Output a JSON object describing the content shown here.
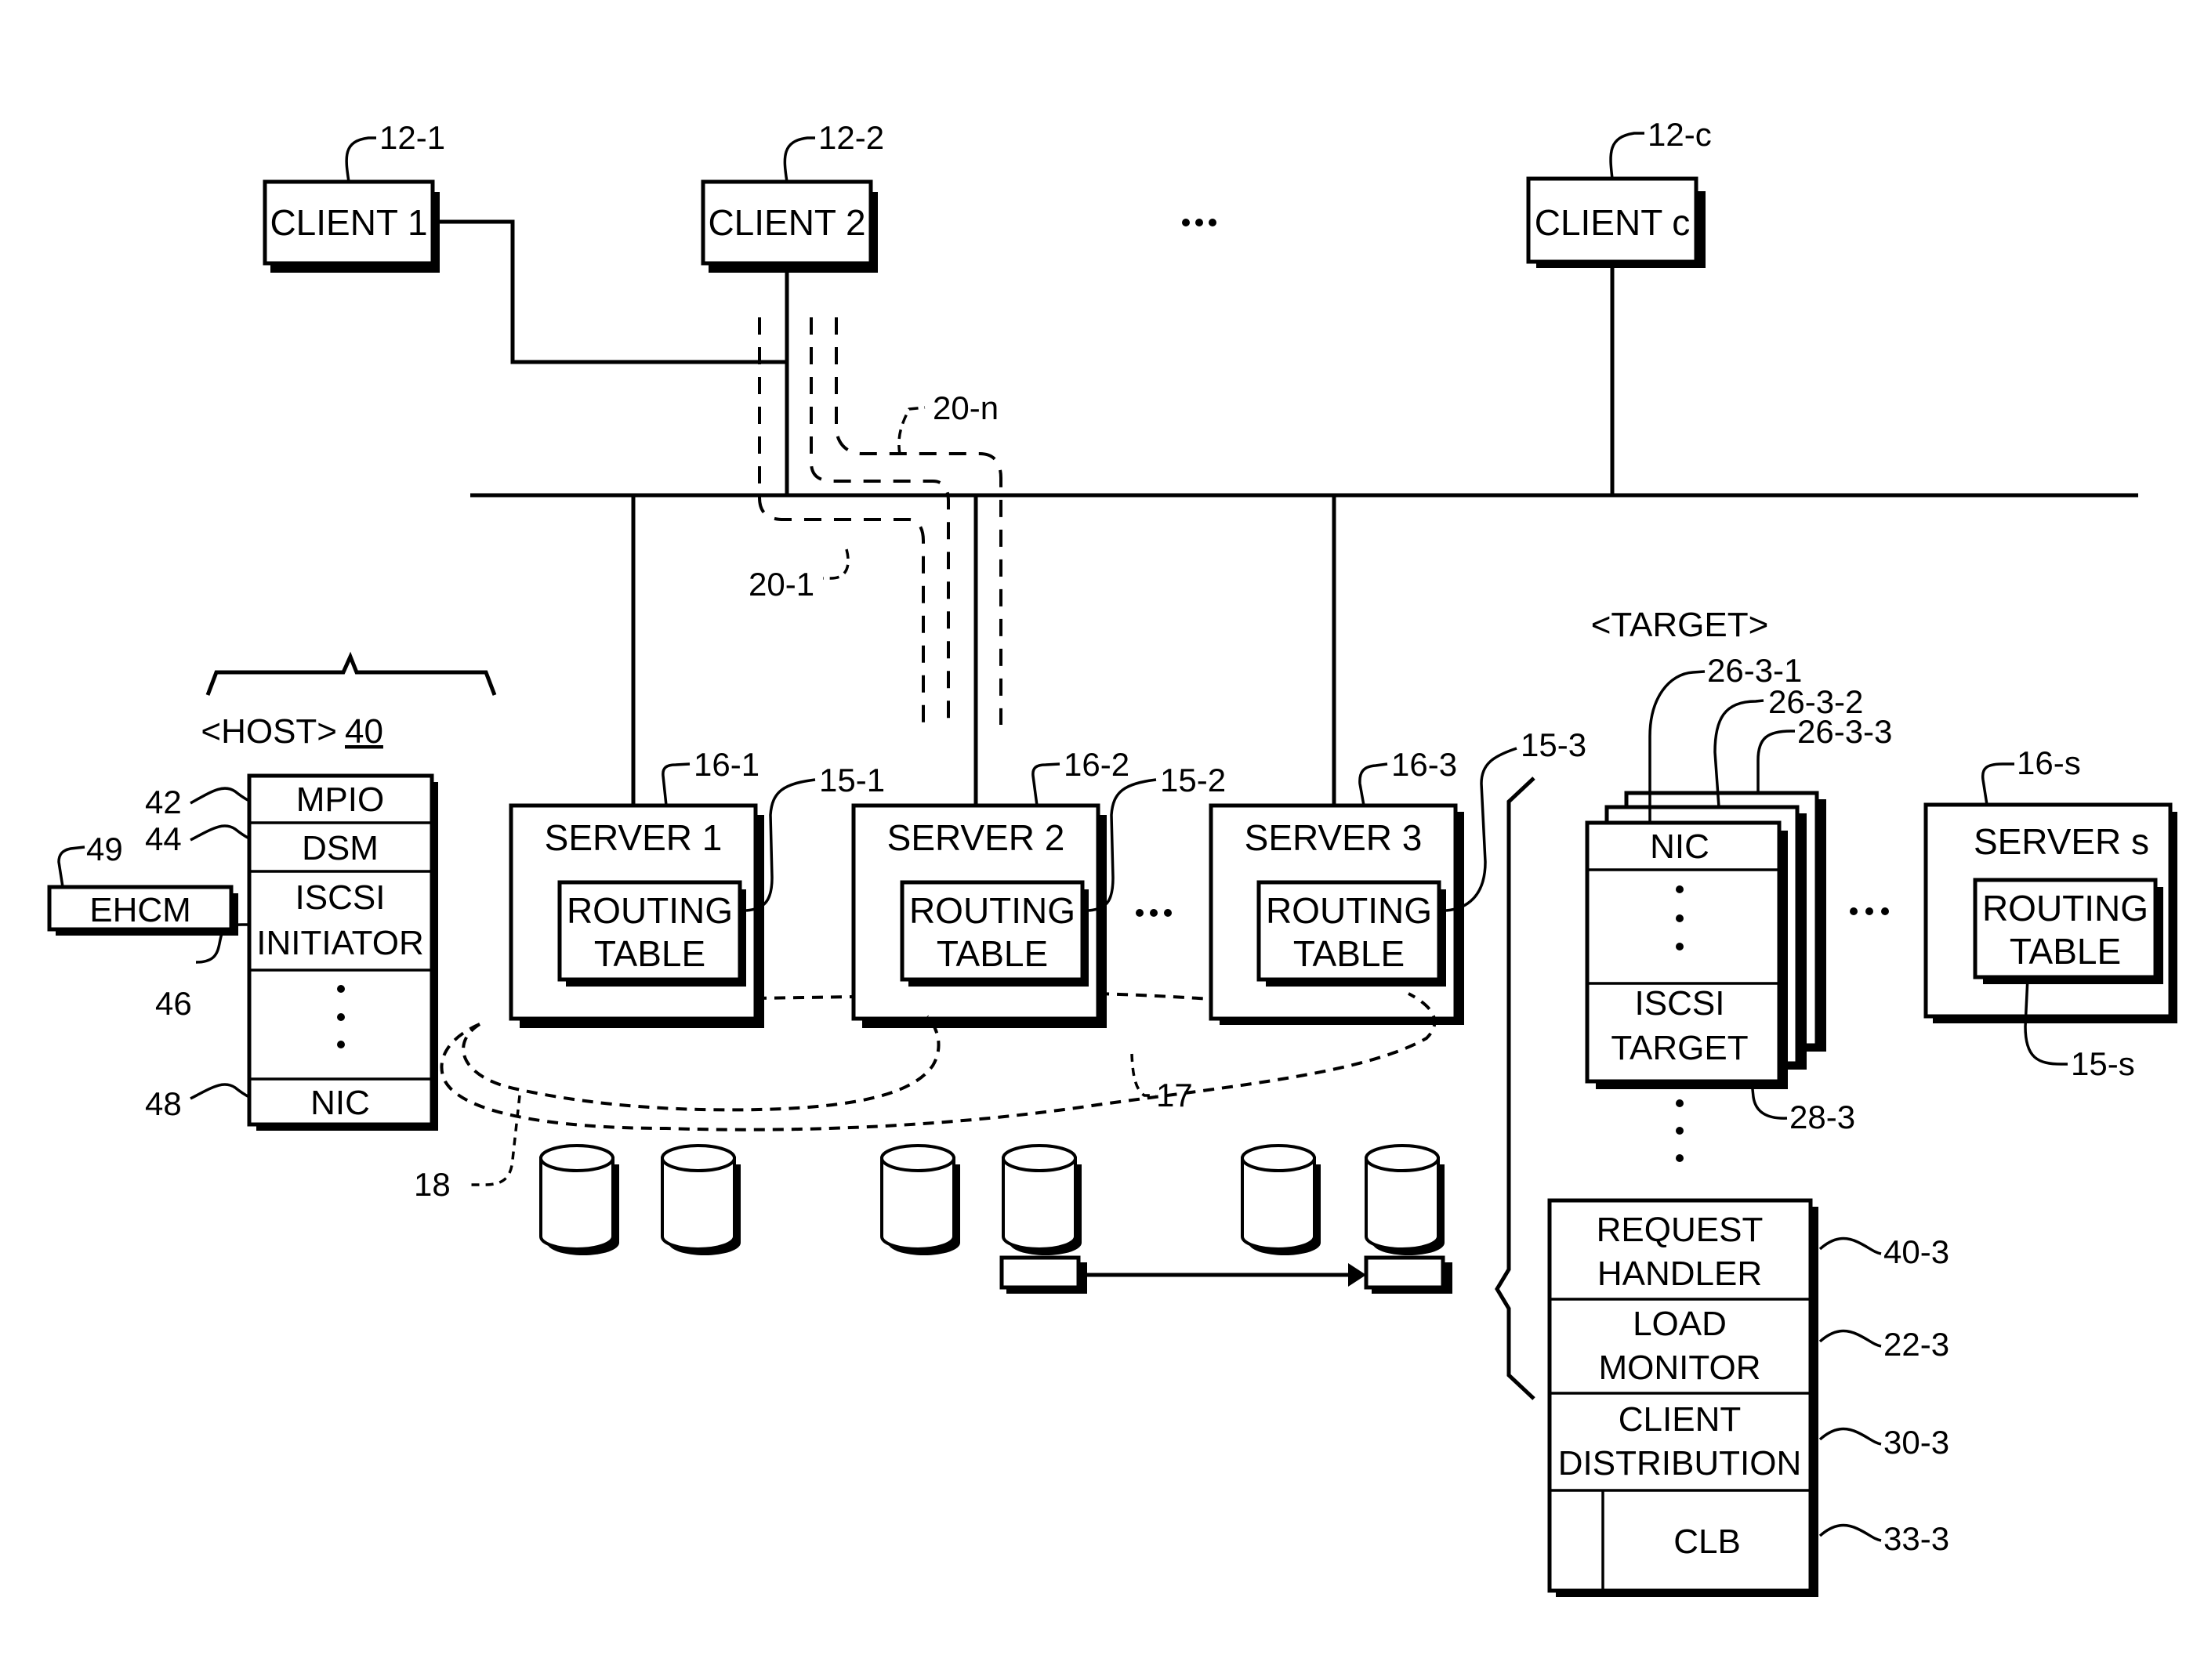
{
  "clients": [
    {
      "label": "CLIENT 1",
      "ref": "12-1"
    },
    {
      "label": "CLIENT 2",
      "ref": "12-2"
    },
    {
      "label": "CLIENT c",
      "ref": "12-c"
    }
  ],
  "paths": {
    "first": "20-1",
    "nth": "20-n"
  },
  "host": {
    "title": "<HOST>",
    "ref": "40",
    "layers": [
      {
        "label": "MPIO",
        "ref": "42"
      },
      {
        "label": "DSM",
        "ref": "44"
      },
      {
        "label": "ISCSI INITIATOR",
        "line1": "ISCSI",
        "line2": "INITIATOR",
        "ref": "46"
      },
      {
        "label": "NIC",
        "ref": "48"
      }
    ],
    "ehcm": {
      "label": "EHCM",
      "ref": "49"
    }
  },
  "servers": [
    {
      "label": "SERVER 1",
      "ref": "16-1",
      "table_line1": "ROUTING",
      "table_line2": "TABLE",
      "table_ref": "15-1"
    },
    {
      "label": "SERVER 2",
      "ref": "16-2",
      "table_line1": "ROUTING",
      "table_line2": "TABLE",
      "table_ref": "15-2"
    },
    {
      "label": "SERVER 3",
      "ref": "16-3",
      "table_line1": "ROUTING",
      "table_line2": "TABLE",
      "table_ref": "15-3"
    },
    {
      "label": "SERVER s",
      "ref": "16-s",
      "table_line1": "ROUTING",
      "table_line2": "TABLE",
      "table_ref": "15-s"
    }
  ],
  "storage": {
    "inner_group_ref": "17",
    "outer_group_ref": "18"
  },
  "target": {
    "title": "<TARGET>",
    "nic_label": "NIC",
    "nic_refs": [
      "26-3-1",
      "26-3-2",
      "26-3-3"
    ],
    "iscsi_line1": "ISCSI",
    "iscsi_line2": "TARGET",
    "iscsi_ref": "28-3",
    "modules": [
      {
        "line1": "REQUEST",
        "line2": "HANDLER",
        "ref": "40-3"
      },
      {
        "line1": "LOAD",
        "line2": "MONITOR",
        "ref": "22-3"
      },
      {
        "line1": "CLIENT",
        "line2": "DISTRIBUTION",
        "ref": "30-3"
      },
      {
        "line1": "CLB",
        "line2": "",
        "ref": "33-3"
      }
    ]
  },
  "ellipsis": "•••"
}
